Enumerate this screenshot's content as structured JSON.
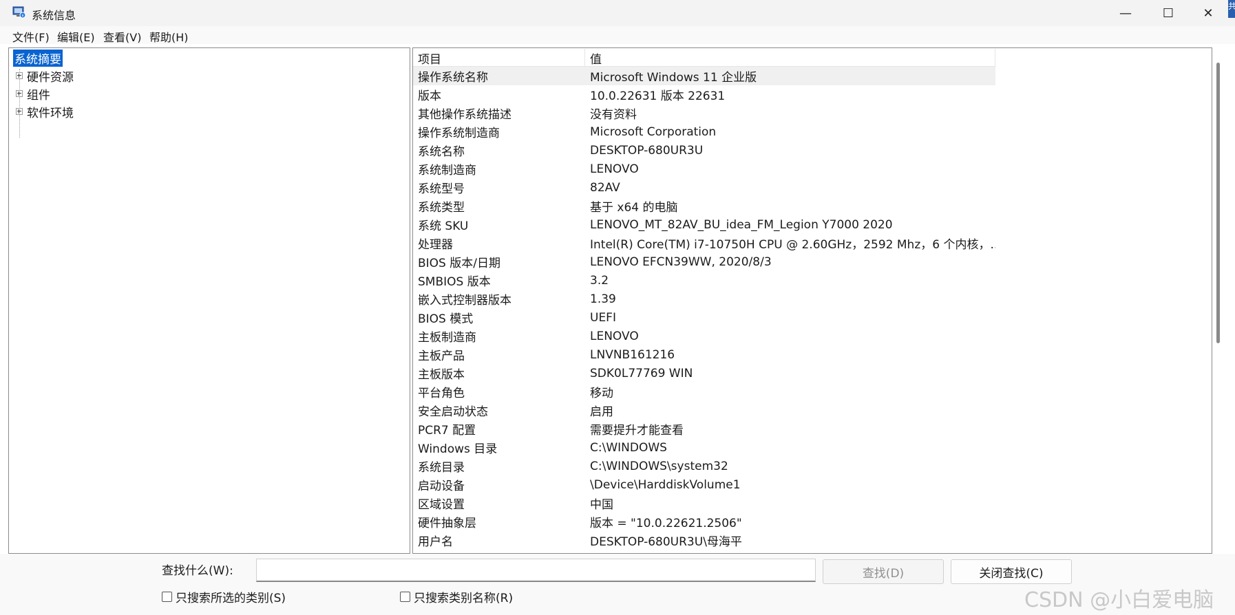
{
  "window": {
    "title": "系统信息",
    "minimize_glyph": "—",
    "maximize_glyph": "☐",
    "close_glyph": "✕",
    "edge_badge": "共"
  },
  "menu": [
    "文件(F)",
    "编辑(E)",
    "查看(V)",
    "帮助(H)"
  ],
  "tree": {
    "selected": "系统摘要",
    "children": [
      "硬件资源",
      "组件",
      "软件环境"
    ]
  },
  "list": {
    "headers": [
      "项目",
      "值"
    ],
    "rows": [
      [
        "操作系统名称",
        "Microsoft Windows 11 企业版"
      ],
      [
        "版本",
        "10.0.22631 版本 22631"
      ],
      [
        "其他操作系统描述",
        "没有资料"
      ],
      [
        "操作系统制造商",
        "Microsoft Corporation"
      ],
      [
        "系统名称",
        "DESKTOP-680UR3U"
      ],
      [
        "系统制造商",
        "LENOVO"
      ],
      [
        "系统型号",
        "82AV"
      ],
      [
        "系统类型",
        "基于 x64 的电脑"
      ],
      [
        "系统 SKU",
        "LENOVO_MT_82AV_BU_idea_FM_Legion Y7000 2020"
      ],
      [
        "处理器",
        "Intel(R) Core(TM) i7-10750H CPU @ 2.60GHz，2592 Mhz，6 个内核，..."
      ],
      [
        "BIOS 版本/日期",
        "LENOVO EFCN39WW, 2020/8/3"
      ],
      [
        "SMBIOS 版本",
        "3.2"
      ],
      [
        "嵌入式控制器版本",
        "1.39"
      ],
      [
        "BIOS 模式",
        "UEFI"
      ],
      [
        "主板制造商",
        "LENOVO"
      ],
      [
        "主板产品",
        "LNVNB161216"
      ],
      [
        "主板版本",
        "SDK0L77769 WIN"
      ],
      [
        "平台角色",
        "移动"
      ],
      [
        "安全启动状态",
        "启用"
      ],
      [
        "PCR7 配置",
        "需要提升才能查看"
      ],
      [
        "Windows 目录",
        "C:\\WINDOWS"
      ],
      [
        "系统目录",
        "C:\\WINDOWS\\system32"
      ],
      [
        "启动设备",
        "\\Device\\HarddiskVolume1"
      ],
      [
        "区域设置",
        "中国"
      ],
      [
        "硬件抽象层",
        "版本 = \"10.0.22621.2506\""
      ],
      [
        "用户名",
        "DESKTOP-680UR3U\\母海平"
      ]
    ]
  },
  "find": {
    "label": "查找什么(W):",
    "value": "",
    "find_button": "查找(D)",
    "close_button": "关闭查找(C)",
    "check_selected_category": "只搜索所选的类别(S)",
    "check_category_names": "只搜索类别名称(R)"
  },
  "watermark": "CSDN @小白爱电脑",
  "colors": {
    "selection": "#0a64d0",
    "titlebar": "#f3f3f3"
  }
}
